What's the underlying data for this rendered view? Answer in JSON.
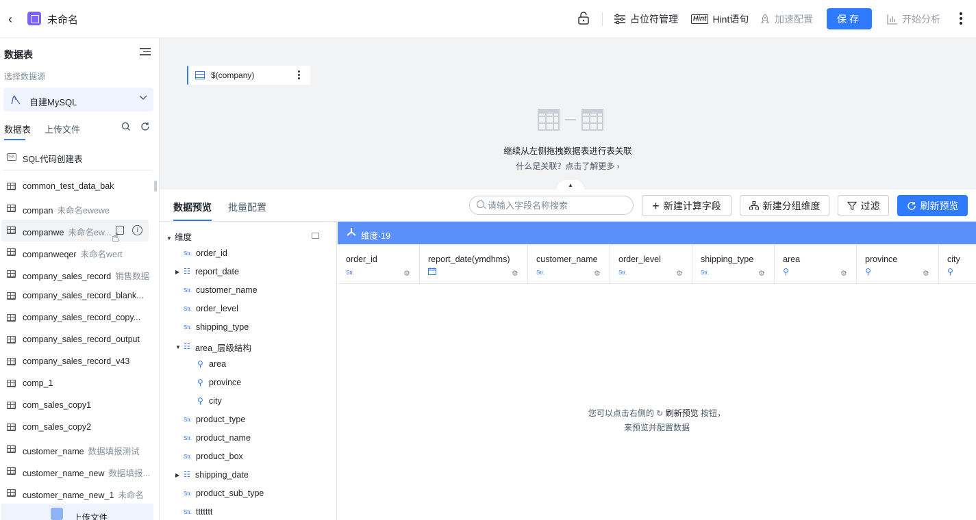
{
  "topbar": {
    "title": "未命名",
    "placeholder_mgmt": "占位符管理",
    "hint_badge": "Hint",
    "hint_label": "Hint语句",
    "accel_config": "加速配置",
    "save": "保存",
    "start_analysis": "开始分析"
  },
  "sidebar": {
    "title": "数据表",
    "select_source_label": "选择数据源",
    "datasource": "自建MySQL",
    "tabs": [
      "数据表",
      "上传文件"
    ],
    "sql_badge": "SQL",
    "sql_create": "SQL代码创建表",
    "tables": [
      {
        "name": "common_test_data_bak",
        "desc": ""
      },
      {
        "name": "compan",
        "desc": "未命名ewewe"
      },
      {
        "name": "companwe",
        "desc": "未命名ew..."
      },
      {
        "name": "companweqer",
        "desc": "未命名wert"
      },
      {
        "name": "company_sales_record",
        "desc": "销售数据"
      },
      {
        "name": "company_sales_record_blank...",
        "desc": ""
      },
      {
        "name": "company_sales_record_copy...",
        "desc": ""
      },
      {
        "name": "company_sales_record_output",
        "desc": ""
      },
      {
        "name": "company_sales_record_v43",
        "desc": ""
      },
      {
        "name": "comp_1",
        "desc": ""
      },
      {
        "name": "com_sales_copy1",
        "desc": ""
      },
      {
        "name": "com_sales_copy2",
        "desc": ""
      },
      {
        "name": "customer_name",
        "desc": "数据填报测试"
      },
      {
        "name": "customer_name_new",
        "desc": "数据填报..."
      },
      {
        "name": "customer_name_new_1",
        "desc": "未命名"
      }
    ],
    "upload_file": "上传文件"
  },
  "canvas": {
    "table_node": "$(company)",
    "hint": "继续从左侧拖拽数据表进行表关联",
    "link": "什么是关联？点击了解更多 ›"
  },
  "bottom": {
    "tabs": [
      "数据预览",
      "批量配置"
    ],
    "search_placeholder": "请输入字段名称搜索",
    "btn_calc_field": "新建计算字段",
    "btn_group_dim": "新建分组维度",
    "btn_filter": "过滤",
    "btn_refresh": "刷新预览",
    "dim_group_title": "维度",
    "str_badge": "Str.",
    "fields": {
      "order_id": "order_id",
      "report_date": "report_date",
      "customer_name": "customer_name",
      "order_level": "order_level",
      "shipping_type": "shipping_type",
      "area_hier": "area_层级结构",
      "area": "area",
      "province": "province",
      "city": "city",
      "product_type": "product_type",
      "product_name": "product_name",
      "product_box": "product_box",
      "shipping_date": "shipping_date",
      "product_sub_type": "product_sub_type",
      "ttttttt": "ttttttt"
    },
    "dim_bar": "维度·19",
    "columns": [
      "order_id",
      "report_date(ymdhms)",
      "customer_name",
      "order_level",
      "shipping_type",
      "area",
      "province",
      "city"
    ],
    "empty_line1_a": "您可以点击右侧的",
    "empty_line1_b": "刷新预览",
    "empty_line1_c": "按钮，",
    "empty_line2": "来预览并配置数据"
  },
  "colors": {
    "primary": "#2f7bff",
    "dim_bar": "#5b8ff9",
    "canvas_bg": "#f2f3f5"
  }
}
